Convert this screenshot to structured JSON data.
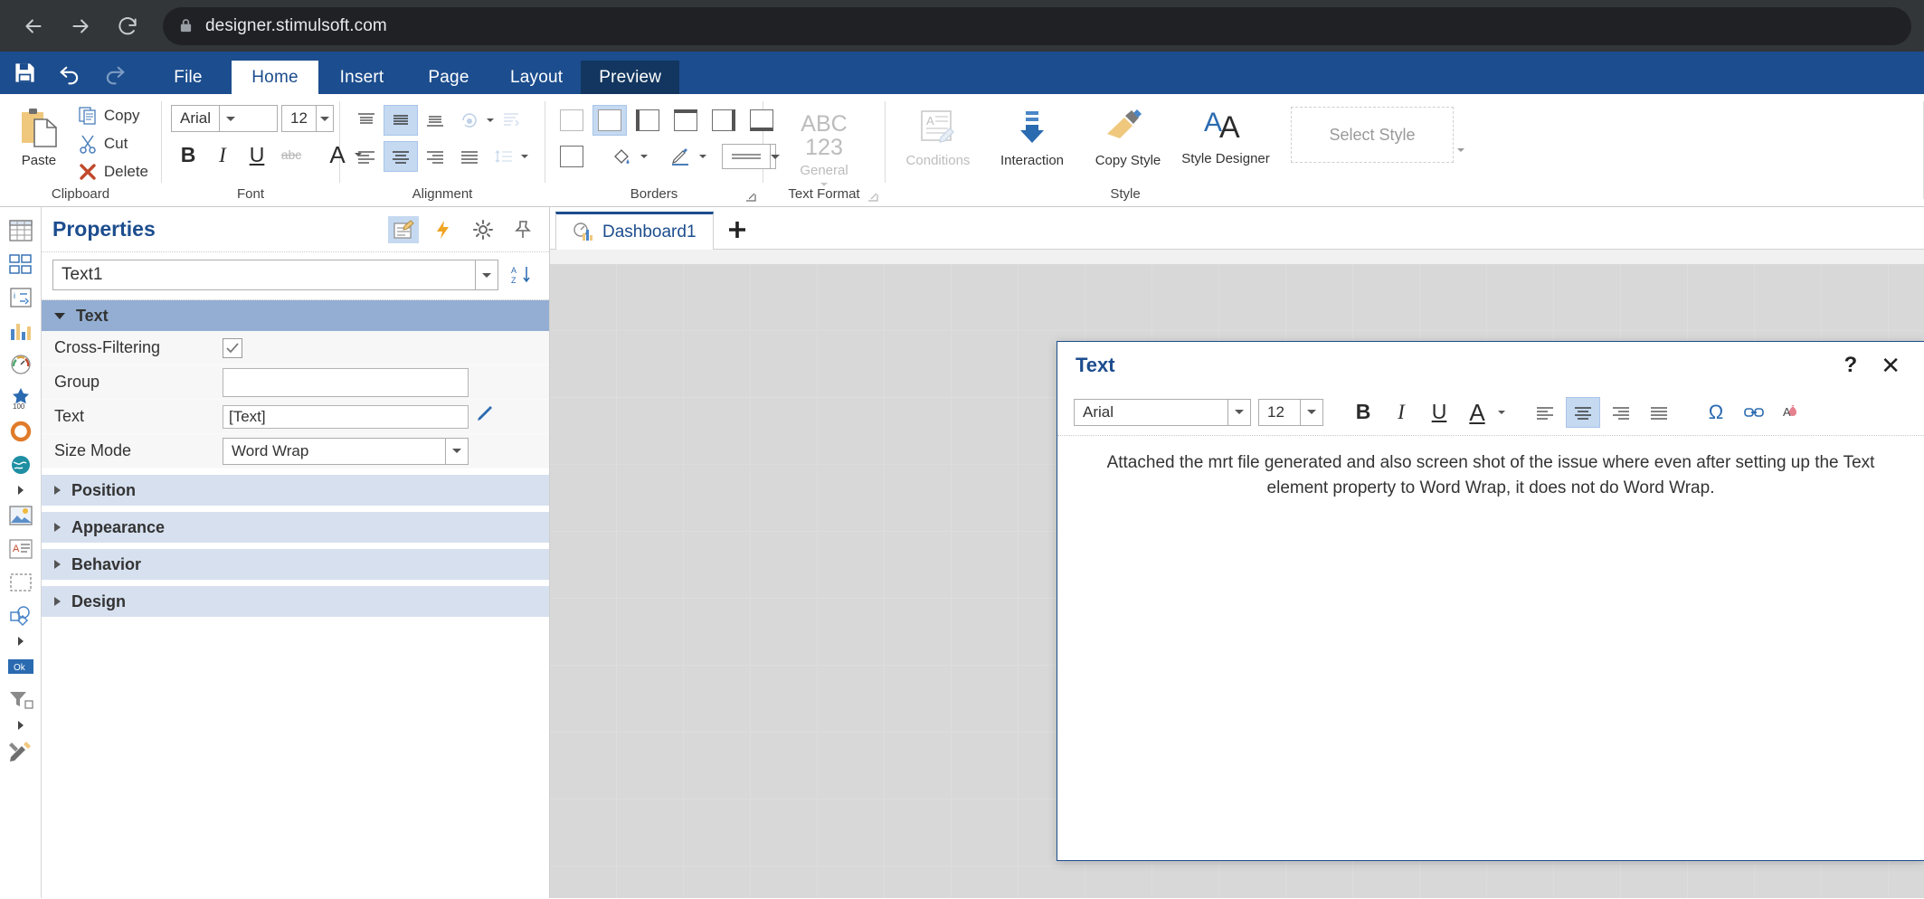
{
  "browser": {
    "url": "designer.stimulsoft.com",
    "back_icon": "back-arrow-icon",
    "forward_icon": "forward-arrow-icon",
    "reload_icon": "reload-icon",
    "lock_icon": "lock-icon"
  },
  "ribbon": {
    "quick_access": {
      "save": "Save",
      "undo": "Undo",
      "redo": "Redo"
    },
    "tabs": [
      {
        "label": "File",
        "state": "normal"
      },
      {
        "label": "Home",
        "state": "active"
      },
      {
        "label": "Insert",
        "state": "normal"
      },
      {
        "label": "Page",
        "state": "normal"
      },
      {
        "label": "Layout",
        "state": "normal"
      },
      {
        "label": "Preview",
        "state": "highlighted"
      }
    ],
    "groups": {
      "clipboard": {
        "label": "Clipboard",
        "paste": "Paste",
        "copy": "Copy",
        "cut": "Cut",
        "delete": "Delete"
      },
      "font": {
        "label": "Font",
        "font_family": "Arial",
        "font_size": "12",
        "bold": "B",
        "italic": "I",
        "underline": "U",
        "strikethrough": "abc",
        "font_color": "A"
      },
      "alignment": {
        "label": "Alignment"
      },
      "borders": {
        "label": "Borders"
      },
      "text_format": {
        "label": "Text Format",
        "value": "ABC 123",
        "sub": "General"
      },
      "style": {
        "label": "Style",
        "conditions": "Conditions",
        "interaction": "Interaction",
        "copy_style": "Copy Style",
        "style_designer": "Style Designer",
        "select_style": "Select Style"
      }
    }
  },
  "toolstrip": {
    "items": [
      {
        "name": "table-icon"
      },
      {
        "name": "cards-icon"
      },
      {
        "name": "indicator-icon"
      },
      {
        "name": "chart-icon"
      },
      {
        "name": "gauge-icon"
      },
      {
        "name": "progress-100-icon"
      },
      {
        "name": "pie-icon"
      },
      {
        "name": "map-icon"
      },
      {
        "name": "image-icon"
      },
      {
        "name": "text-element-icon"
      },
      {
        "name": "panel-icon"
      },
      {
        "name": "shape-icon"
      },
      {
        "name": "button-ok-icon"
      },
      {
        "name": "filter-icon"
      },
      {
        "name": "tools-icon"
      }
    ]
  },
  "properties": {
    "title": "Properties",
    "header_buttons": [
      {
        "name": "style-properties-icon",
        "selected": true
      },
      {
        "name": "events-icon",
        "selected": false
      },
      {
        "name": "settings-gear-icon",
        "selected": false
      },
      {
        "name": "pin-icon",
        "selected": false
      }
    ],
    "selected_object": "Text1",
    "sort_icon": "sort-az-icon",
    "sections": [
      {
        "label": "Text",
        "expanded": true,
        "rows": [
          {
            "label": "Cross-Filtering",
            "type": "checkbox",
            "value": "checked"
          },
          {
            "label": "Group",
            "type": "text",
            "value": ""
          },
          {
            "label": "Text",
            "type": "text-expression",
            "value": "[Text]"
          },
          {
            "label": "Size Mode",
            "type": "select",
            "value": "Word Wrap"
          }
        ]
      },
      {
        "label": "Position",
        "expanded": false,
        "rows": []
      },
      {
        "label": "Appearance",
        "expanded": false,
        "rows": []
      },
      {
        "label": "Behavior",
        "expanded": false,
        "rows": []
      },
      {
        "label": "Design",
        "expanded": false,
        "rows": []
      }
    ]
  },
  "workspace": {
    "tabs": [
      {
        "label": "Dashboard1",
        "icon": "dashboard-icon",
        "active": true
      }
    ],
    "add_tab": "+",
    "text_element": {
      "content": "Attached the mrt file generated and also screen shot of the issue where even after setting up the Text element property to Word Wrap, it does not do Word Wrap."
    }
  },
  "dialog": {
    "title": "Text",
    "help_label": "?",
    "close_label": "✕",
    "toolbar": {
      "font_family": "Arial",
      "font_size": "12",
      "bold": "B",
      "italic": "I",
      "underline": "U",
      "font_color": "A",
      "align_left": "align-left-icon",
      "align_center": "align-center-icon",
      "align_right": "align-right-icon",
      "align_justify": "align-justify-icon",
      "symbol": "Ω",
      "hyperlink": "hyperlink-icon",
      "clear_format": "clear-format-icon"
    },
    "content": "Attached the mrt file generated and also screen shot of the issue where even after setting up the Text element property to Word Wrap, it does not do Word Wrap."
  },
  "colors": {
    "ribbon_blue": "#1c4d8e",
    "tab_dark": "#12365f",
    "selection_blue": "#c5d9f1",
    "section_open": "#93aed2",
    "section_closed": "#d6e0ef",
    "chrome_dark": "#323639",
    "omnibox_dark": "#202124"
  }
}
